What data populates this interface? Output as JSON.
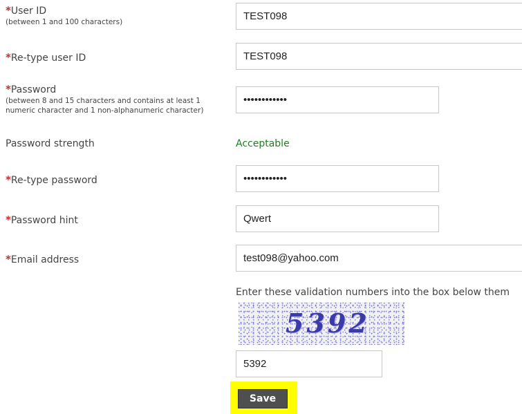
{
  "form": {
    "required_mark": "*",
    "user_id": {
      "label": "User ID",
      "hint": "(between 1 and 100 characters)",
      "value": "TEST098"
    },
    "retype_user_id": {
      "label": "Re-type user ID",
      "value": "TEST098"
    },
    "password": {
      "label": "Password",
      "hint_line1": "(between 8 and 15 characters and contains at least 1",
      "hint_line2": "numeric character and 1 non-alphanumeric character)",
      "value": "••••••••••••"
    },
    "password_strength": {
      "label": "Password strength",
      "value": "Acceptable",
      "color": "#1e7e1e"
    },
    "retype_password": {
      "label": "Re-type password",
      "value": "••••••••••••"
    },
    "password_hint": {
      "label": "Password hint",
      "value": "Qwert"
    },
    "email": {
      "label": "Email address",
      "value": "test098@yahoo.com"
    },
    "captcha": {
      "instruction": "Enter these validation numbers into the box below them",
      "image_text": "5392",
      "input_value": "5392"
    },
    "save_label": "Save",
    "highlight_color": "#ffff00"
  }
}
